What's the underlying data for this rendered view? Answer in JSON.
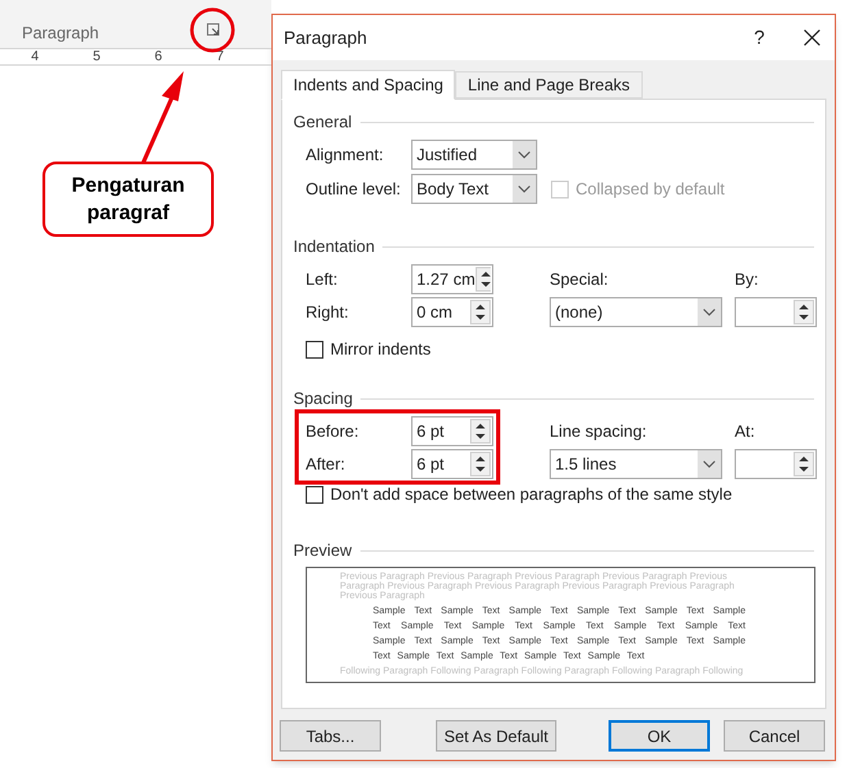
{
  "ribbon": {
    "group_label": "Paragraph",
    "ruler_numbers": [
      "4",
      "5",
      "6",
      "7"
    ]
  },
  "callout": {
    "text": "Pengaturan paragraf"
  },
  "dialog": {
    "title": "Paragraph",
    "help": "?",
    "tabs": [
      {
        "label": "Indents and Spacing",
        "selected": true
      },
      {
        "label": "Line and Page Breaks",
        "selected": false
      }
    ],
    "general": {
      "heading": "General",
      "alignment": {
        "label": "Alignment:",
        "value": "Justified"
      },
      "outline_level": {
        "label": "Outline level:",
        "value": "Body Text"
      },
      "collapsed": {
        "label": "Collapsed by default",
        "checked": false,
        "disabled": true
      }
    },
    "indentation": {
      "heading": "Indentation",
      "left": {
        "label": "Left:",
        "value": "1.27 cm"
      },
      "right": {
        "label": "Right:",
        "value": "0 cm"
      },
      "special": {
        "label": "Special:",
        "value": "(none)"
      },
      "by": {
        "label": "By:"
      },
      "mirror": {
        "label": "Mirror indents",
        "checked": false
      }
    },
    "spacing": {
      "heading": "Spacing",
      "highlighted": true,
      "before": {
        "label": "Before:",
        "value": "6 pt"
      },
      "after": {
        "label": "After:",
        "value": "6 pt"
      },
      "line_spacing": {
        "label": "Line spacing:",
        "value": "1.5 lines"
      },
      "at": {
        "label": "At:"
      },
      "dont_add": {
        "label": "Don't add space between paragraphs of the same style",
        "checked": false
      }
    },
    "preview": {
      "heading": "Preview",
      "previous": "Previous Paragraph Previous Paragraph Previous Paragraph Previous Paragraph Previous Paragraph Previous Paragraph Previous Paragraph Previous Paragraph Previous Paragraph Previous Paragraph",
      "sample": "Sample Text Sample Text Sample Text Sample Text Sample Text Sample Text Sample Text Sample Text Sample Text Sample Text Sample Text Sample Text Sample Text Sample Text Sample Text Sample Text Sample Text Sample Text Sample Text Sample Text Sample Text",
      "following": "Following Paragraph Following Paragraph Following Paragraph Following Paragraph Following"
    },
    "buttons": [
      {
        "label": "Tabs...",
        "default": false
      },
      {
        "label": "Set As Default",
        "default": false
      },
      {
        "label": "OK",
        "default": true
      },
      {
        "label": "Cancel",
        "default": false
      }
    ]
  }
}
